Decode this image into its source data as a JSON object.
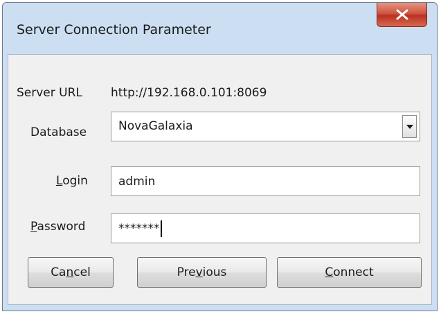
{
  "window": {
    "title": "Server Connection Parameter"
  },
  "icons": {
    "close": "close-x-icon",
    "dropdown": "chevron-down-icon"
  },
  "form": {
    "server_url": {
      "label": "Server URL",
      "value": "http://192.168.0.101:8069"
    },
    "database": {
      "label": "Database",
      "value": "NovaGalaxia"
    },
    "login": {
      "label_pre": "",
      "label_mnemonic": "L",
      "label_post": "ogin",
      "value": "admin"
    },
    "password": {
      "label_pre": "",
      "label_mnemonic": "P",
      "label_post": "assword",
      "value": "*******"
    }
  },
  "buttons": {
    "cancel": {
      "pre": "Ca",
      "mnemonic": "n",
      "post": "cel"
    },
    "previous": {
      "pre": "Pre",
      "mnemonic": "v",
      "post": "ious"
    },
    "connect": {
      "pre": "",
      "mnemonic": "C",
      "post": "onnect"
    }
  }
}
